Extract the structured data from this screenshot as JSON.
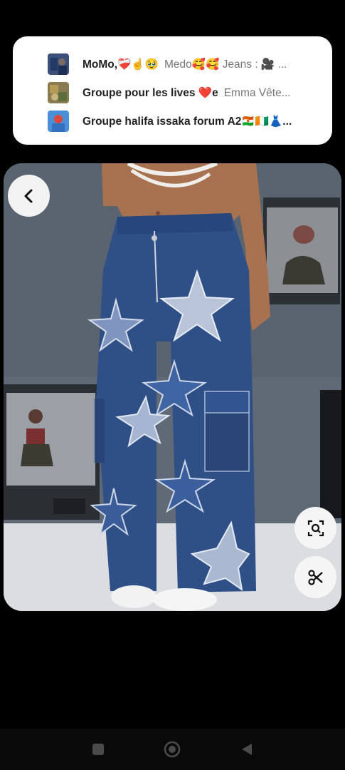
{
  "share_popup": {
    "items": [
      {
        "name": "MoMo,❤️‍🩹☝️🥹",
        "preview": "Medo🥰🥰 Jeans : 🎥 ..."
      },
      {
        "name": "Groupe pour les lives ❤️e",
        "preview": "Emma Vête..."
      },
      {
        "name": "Groupe halifa issaka forum A2🇳🇪🇨🇮👗...",
        "preview": ""
      }
    ]
  },
  "viewer": {
    "back_icon": "chevron-left-icon",
    "lens_icon": "visual-search-icon",
    "cut_icon": "scissors-icon"
  },
  "navbar": {
    "recents_icon": "square-icon",
    "home_icon": "circle-icon",
    "back_icon": "triangle-back-icon"
  },
  "colors": {
    "background": "#000000",
    "popup": "#ffffff",
    "denim": "#2f4f87"
  }
}
